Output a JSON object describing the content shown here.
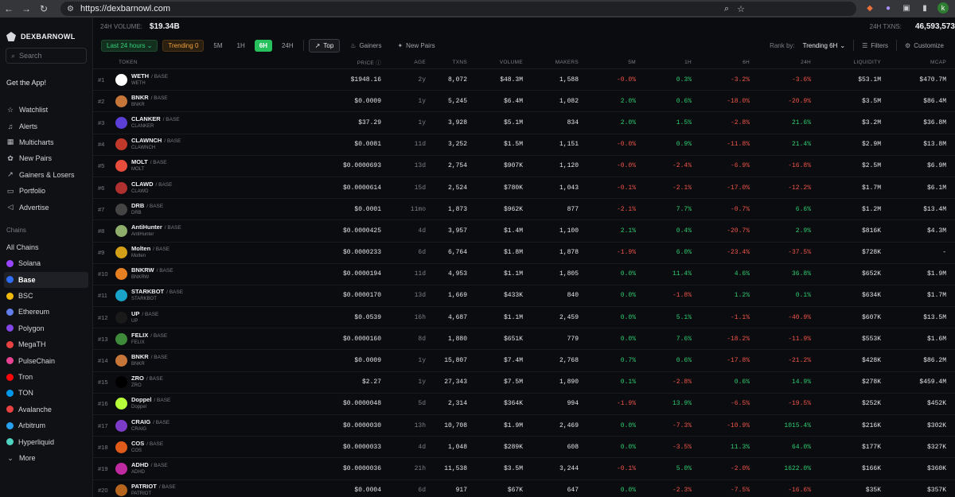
{
  "browser": {
    "url": "https://dexbarnowl.com",
    "profile_initial": "k"
  },
  "sidebar": {
    "brand": "DEXBARNOWL",
    "search_placeholder": "Search",
    "get_app": "Get the App!",
    "menu": [
      {
        "label": "Watchlist",
        "icon": "star-icon"
      },
      {
        "label": "Alerts",
        "icon": "bell-icon"
      },
      {
        "label": "Multicharts",
        "icon": "grid-icon"
      },
      {
        "label": "New Pairs",
        "icon": "sprout-icon"
      },
      {
        "label": "Gainers & Losers",
        "icon": "trend-icon"
      },
      {
        "label": "Portfolio",
        "icon": "folder-icon"
      },
      {
        "label": "Advertise",
        "icon": "megaphone-icon"
      }
    ],
    "chains_heading": "Chains",
    "chains": [
      {
        "label": "All Chains",
        "color": ""
      },
      {
        "label": "Solana",
        "color": "#9945ff"
      },
      {
        "label": "Base",
        "color": "#2f6df6"
      },
      {
        "label": "BSC",
        "color": "#f0b90b"
      },
      {
        "label": "Ethereum",
        "color": "#627eea"
      },
      {
        "label": "Polygon",
        "color": "#8247e5"
      },
      {
        "label": "MegaTH",
        "color": "#e84142"
      },
      {
        "label": "PulseChain",
        "color": "#e84393"
      },
      {
        "label": "Tron",
        "color": "#ff060a"
      },
      {
        "label": "TON",
        "color": "#0098ea"
      },
      {
        "label": "Avalanche",
        "color": "#e84142"
      },
      {
        "label": "Arbitrum",
        "color": "#28a0f0"
      },
      {
        "label": "Hyperliquid",
        "color": "#50d2c1"
      }
    ],
    "more": "More"
  },
  "stats": {
    "volume_label": "24H VOLUME:",
    "volume": "$19.34B",
    "txns_label": "24H TXNS:",
    "txns": "46,593,573"
  },
  "filters": {
    "period": "Last 24 hours",
    "trending": "Trending",
    "trending_count": "0",
    "timeframes": [
      "5M",
      "1H",
      "6H",
      "24H"
    ],
    "active_timeframe": "6H",
    "top": "Top",
    "gainers": "Gainers",
    "new_pairs": "New Pairs",
    "rank_by_label": "Rank by:",
    "rank_by_value": "Trending 6H",
    "filters_btn": "Filters",
    "customize_btn": "Customize"
  },
  "columns": [
    "TOKEN",
    "PRICE",
    "AGE",
    "TXNS",
    "VOLUME",
    "MAKERS",
    "5M",
    "1H",
    "6H",
    "24H",
    "LIQUIDITY",
    "MCAP"
  ],
  "rows": [
    {
      "rank": "#1",
      "sym": "WETH",
      "name": "WETH",
      "color": "#ffffff",
      "price": "$1948.16",
      "age": "2y",
      "txns": "8,072",
      "vol": "$48.3M",
      "makers": "1,588",
      "m5": "-0.0%",
      "h1": "0.3%",
      "h6": "-3.2%",
      "h24": "-3.6%",
      "liq": "$53.1M",
      "mcap": "$470.7M"
    },
    {
      "rank": "#2",
      "sym": "BNKR",
      "name": "BNKR",
      "color": "#c7763a",
      "price": "$0.0009",
      "age": "1y",
      "txns": "5,245",
      "vol": "$6.4M",
      "makers": "1,082",
      "m5": "2.0%",
      "h1": "0.6%",
      "h6": "-18.0%",
      "h24": "-20.9%",
      "liq": "$3.5M",
      "mcap": "$86.4M"
    },
    {
      "rank": "#3",
      "sym": "CLANKER",
      "name": "CLANKER",
      "color": "#5b3fd6",
      "price": "$37.29",
      "age": "1y",
      "txns": "3,928",
      "vol": "$5.1M",
      "makers": "834",
      "m5": "2.0%",
      "h1": "1.5%",
      "h6": "-2.8%",
      "h24": "21.6%",
      "liq": "$3.2M",
      "mcap": "$36.8M"
    },
    {
      "rank": "#4",
      "sym": "CLAWNCH",
      "name": "CLAWNCH",
      "color": "#c0392b",
      "price": "$0.0081",
      "age": "11d",
      "txns": "3,252",
      "vol": "$1.5M",
      "makers": "1,151",
      "m5": "-0.0%",
      "h1": "0.9%",
      "h6": "-11.8%",
      "h24": "21.4%",
      "liq": "$2.9M",
      "mcap": "$13.8M"
    },
    {
      "rank": "#5",
      "sym": "MOLT",
      "name": "MOLT",
      "color": "#e74c3c",
      "price": "$0.0000693",
      "age": "13d",
      "txns": "2,754",
      "vol": "$907K",
      "makers": "1,120",
      "m5": "-0.0%",
      "h1": "-2.4%",
      "h6": "-6.9%",
      "h24": "-16.8%",
      "liq": "$2.5M",
      "mcap": "$6.9M"
    },
    {
      "rank": "#6",
      "sym": "CLAWD",
      "name": "CLAWD",
      "color": "#b03030",
      "price": "$0.0000614",
      "age": "15d",
      "txns": "2,524",
      "vol": "$780K",
      "makers": "1,043",
      "m5": "-0.1%",
      "h1": "-2.1%",
      "h6": "-17.0%",
      "h24": "-12.2%",
      "liq": "$1.7M",
      "mcap": "$6.1M"
    },
    {
      "rank": "#7",
      "sym": "DRB",
      "name": "DRB",
      "color": "#444444",
      "price": "$0.0001",
      "age": "11mo",
      "txns": "1,873",
      "vol": "$962K",
      "makers": "877",
      "m5": "-2.1%",
      "h1": "7.7%",
      "h6": "-0.7%",
      "h24": "6.6%",
      "liq": "$1.2M",
      "mcap": "$13.4M"
    },
    {
      "rank": "#8",
      "sym": "AntiHunter",
      "name": "AntiHunter",
      "color": "#8fae6b",
      "price": "$0.0000425",
      "age": "4d",
      "txns": "3,957",
      "vol": "$1.4M",
      "makers": "1,100",
      "m5": "2.1%",
      "h1": "0.4%",
      "h6": "-20.7%",
      "h24": "2.9%",
      "liq": "$816K",
      "mcap": "$4.3M"
    },
    {
      "rank": "#9",
      "sym": "Molten",
      "name": "Molten",
      "color": "#d4a017",
      "price": "$0.0000233",
      "age": "6d",
      "txns": "6,764",
      "vol": "$1.8M",
      "makers": "1,878",
      "m5": "-1.9%",
      "h1": "6.0%",
      "h6": "-23.4%",
      "h24": "-37.5%",
      "liq": "$728K",
      "mcap": "-"
    },
    {
      "rank": "#10",
      "sym": "BNKRW",
      "name": "BNKRW",
      "color": "#e67e22",
      "price": "$0.0000194",
      "age": "11d",
      "txns": "4,953",
      "vol": "$1.1M",
      "makers": "1,805",
      "m5": "0.0%",
      "h1": "11.4%",
      "h6": "4.6%",
      "h24": "36.8%",
      "liq": "$652K",
      "mcap": "$1.9M"
    },
    {
      "rank": "#11",
      "sym": "STARKBOT",
      "name": "STARKBOT",
      "color": "#1aa3c9",
      "price": "$0.0000170",
      "age": "13d",
      "txns": "1,669",
      "vol": "$433K",
      "makers": "840",
      "m5": "0.0%",
      "h1": "-1.8%",
      "h6": "1.2%",
      "h24": "0.1%",
      "liq": "$634K",
      "mcap": "$1.7M"
    },
    {
      "rank": "#12",
      "sym": "UP",
      "name": "UP",
      "color": "#1a1a1a",
      "price": "$0.0539",
      "age": "16h",
      "txns": "4,687",
      "vol": "$1.1M",
      "makers": "2,459",
      "m5": "0.0%",
      "h1": "5.1%",
      "h6": "-1.1%",
      "h24": "-40.9%",
      "liq": "$607K",
      "mcap": "$13.5M"
    },
    {
      "rank": "#13",
      "sym": "FELIX",
      "name": "FELIX",
      "color": "#3f8a3a",
      "price": "$0.0000160",
      "age": "8d",
      "txns": "1,880",
      "vol": "$651K",
      "makers": "779",
      "m5": "0.0%",
      "h1": "7.6%",
      "h6": "-18.2%",
      "h24": "-11.9%",
      "liq": "$553K",
      "mcap": "$1.6M"
    },
    {
      "rank": "#14",
      "sym": "BNKR",
      "name": "BNKR",
      "color": "#c7763a",
      "price": "$0.0009",
      "age": "1y",
      "txns": "15,807",
      "vol": "$7.4M",
      "makers": "2,768",
      "m5": "0.7%",
      "h1": "0.6%",
      "h6": "-17.8%",
      "h24": "-21.2%",
      "liq": "$428K",
      "mcap": "$86.2M"
    },
    {
      "rank": "#15",
      "sym": "ZRO",
      "name": "ZRO",
      "color": "#000000",
      "price": "$2.27",
      "age": "1y",
      "txns": "27,343",
      "vol": "$7.5M",
      "makers": "1,890",
      "m5": "0.1%",
      "h1": "-2.8%",
      "h6": "0.6%",
      "h24": "14.9%",
      "liq": "$278K",
      "mcap": "$459.4M"
    },
    {
      "rank": "#16",
      "sym": "Doppel",
      "name": "Doppel",
      "color": "#b6ff3a",
      "price": "$0.0000048",
      "age": "5d",
      "txns": "2,314",
      "vol": "$364K",
      "makers": "994",
      "m5": "-1.9%",
      "h1": "13.9%",
      "h6": "-6.5%",
      "h24": "-19.5%",
      "liq": "$252K",
      "mcap": "$452K"
    },
    {
      "rank": "#17",
      "sym": "CRAIG",
      "name": "CRAIG",
      "color": "#7d3cc8",
      "price": "$0.0000030",
      "age": "13h",
      "txns": "10,708",
      "vol": "$1.9M",
      "makers": "2,469",
      "m5": "0.0%",
      "h1": "-7.3%",
      "h6": "-10.9%",
      "h24": "1015.4%",
      "liq": "$216K",
      "mcap": "$302K"
    },
    {
      "rank": "#18",
      "sym": "COS",
      "name": "COS",
      "color": "#e05a1a",
      "price": "$0.0000033",
      "age": "4d",
      "txns": "1,048",
      "vol": "$289K",
      "makers": "608",
      "m5": "0.0%",
      "h1": "-3.5%",
      "h6": "11.3%",
      "h24": "64.0%",
      "liq": "$177K",
      "mcap": "$327K"
    },
    {
      "rank": "#19",
      "sym": "ADHD",
      "name": "ADHD",
      "color": "#c02aa0",
      "price": "$0.0000036",
      "age": "21h",
      "txns": "11,538",
      "vol": "$3.5M",
      "makers": "3,244",
      "m5": "-0.1%",
      "h1": "5.0%",
      "h6": "-2.0%",
      "h24": "1622.0%",
      "liq": "$166K",
      "mcap": "$360K"
    },
    {
      "rank": "#20",
      "sym": "PATRIOT",
      "name": "PATRIOT",
      "color": "#b5651d",
      "price": "$0.0004",
      "age": "6d",
      "txns": "917",
      "vol": "$67K",
      "makers": "647",
      "m5": "0.0%",
      "h1": "-2.3%",
      "h6": "-7.5%",
      "h24": "-16.6%",
      "liq": "$35K",
      "mcap": "$357K"
    }
  ],
  "base_label": "/ BASE"
}
